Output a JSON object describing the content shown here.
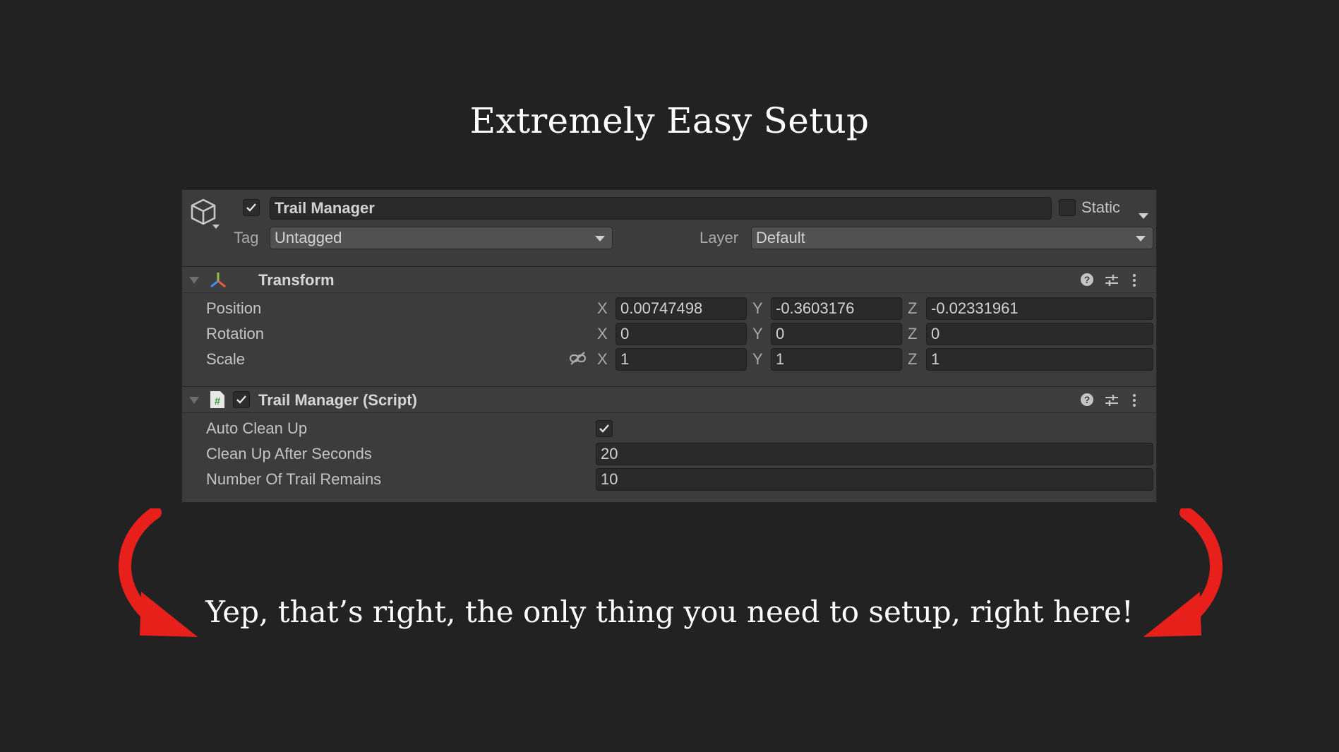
{
  "title": "Extremely Easy Setup",
  "caption": "Yep, that’s right, the only thing you need to setup, right here!",
  "colors": {
    "background": "#222222",
    "arrow": "#e8201c",
    "panel": "#3c3c3c"
  },
  "inspector": {
    "object": {
      "icon": "gameobject-cube-icon",
      "active": true,
      "name": "Trail Manager",
      "static_label": "Static",
      "static_checked": false,
      "tag_label": "Tag",
      "tag_value": "Untagged",
      "layer_label": "Layer",
      "layer_value": "Default"
    },
    "transform": {
      "title": "Transform",
      "icon": "transform-axes-icon",
      "rows": [
        {
          "label": "Position",
          "x": "0.00747498",
          "y": "-0.3603176",
          "z": "-0.02331961"
        },
        {
          "label": "Rotation",
          "x": "0",
          "y": "0",
          "z": "0"
        },
        {
          "label": "Scale",
          "x": "1",
          "y": "1",
          "z": "1"
        }
      ],
      "axis_labels": {
        "x": "X",
        "y": "Y",
        "z": "Z"
      }
    },
    "script": {
      "title": "Trail Manager (Script)",
      "icon": "script-hash-icon",
      "enabled": true,
      "fields": [
        {
          "label": "Auto Clean Up",
          "type": "checkbox",
          "checked": true
        },
        {
          "label": "Clean Up After Seconds",
          "type": "number",
          "value": "20"
        },
        {
          "label": "Number Of Trail Remains",
          "type": "number",
          "value": "10"
        }
      ]
    }
  }
}
